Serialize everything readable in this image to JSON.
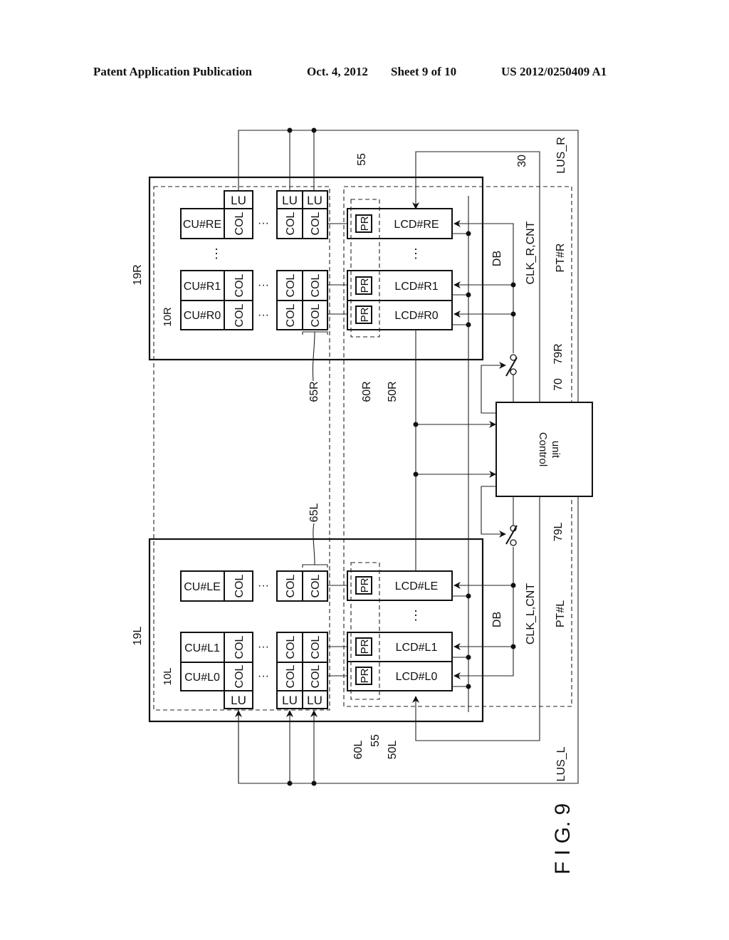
{
  "header": {
    "publication": "Patent Application Publication",
    "date": "Oct. 4, 2012",
    "sheet": "Sheet 9 of 10",
    "number": "US 2012/0250409 A1"
  },
  "figure": {
    "caption": "F I G. 9",
    "labels": {
      "block_r": "19R",
      "block_l": "19L",
      "array_r": "10R",
      "array_l": "10L",
      "col_group_r": "65R",
      "col_group_l": "65L",
      "pr_group_r": "60R",
      "pr_group_l": "60L",
      "lcd_group_r": "50R",
      "lcd_group_l": "50L",
      "pr_ref_r": "55",
      "pr_ref_l": "55",
      "region_30": "30",
      "control_ref": "70",
      "switch_r": "79R",
      "switch_l": "79L",
      "bus_r": "LUS_R",
      "bus_l": "LUS_L",
      "clk_r": "CLK_R,CNT",
      "clk_l": "CLK_L,CNT",
      "pt_r": "PT#R",
      "pt_l": "PT#L",
      "db_r": "DB",
      "db_l": "DB",
      "control_line1": "Control",
      "control_line2": "unit"
    },
    "cells": {
      "cu_re": "CU#RE",
      "cu_r1": "CU#R1",
      "cu_r0": "CU#R0",
      "cu_le": "CU#LE",
      "cu_l1": "CU#L1",
      "cu_l0": "CU#L0",
      "col": "COL",
      "lu": "LU",
      "pr": "PR",
      "lcd_re": "LCD#RE",
      "lcd_r1": "LCD#R1",
      "lcd_r0": "LCD#R0",
      "lcd_le": "LCD#LE",
      "lcd_l1": "LCD#L1",
      "lcd_l0": "LCD#L0",
      "ellipsis_h": "···",
      "ellipsis_v": "⋮"
    }
  }
}
